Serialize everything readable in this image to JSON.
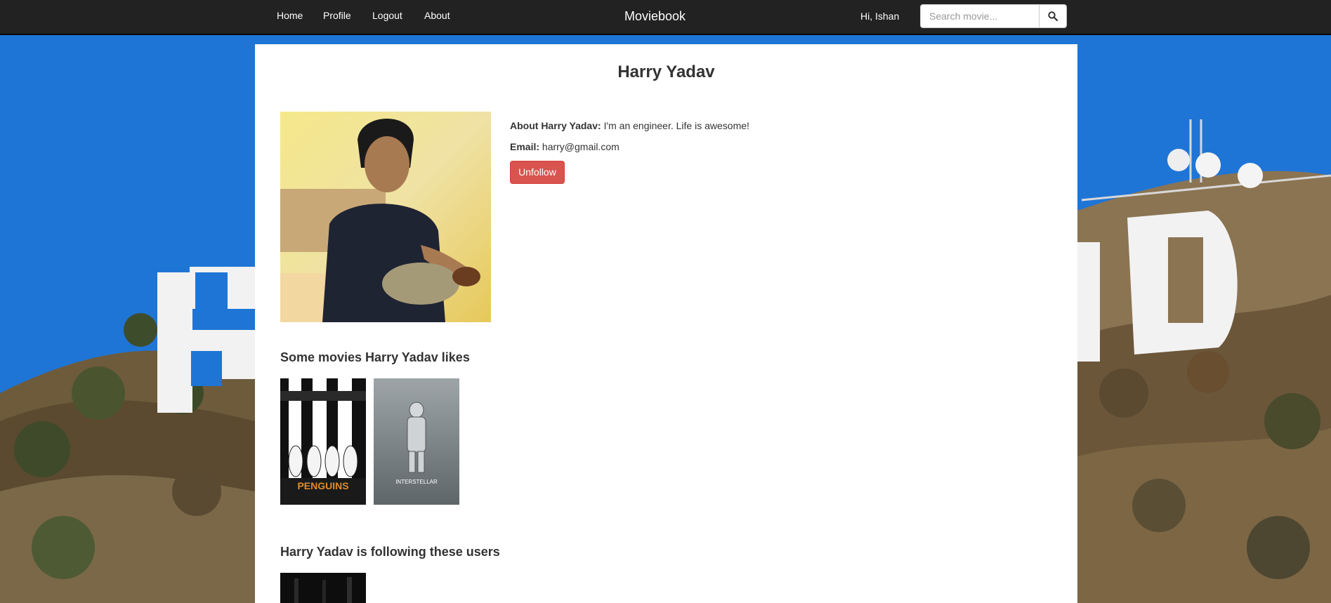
{
  "navbar": {
    "links": [
      "Home",
      "Profile",
      "Logout",
      "About"
    ],
    "brand": "Moviebook",
    "greeting": "Hi, Ishan",
    "search_placeholder": "Search movie..."
  },
  "profile": {
    "name": "Harry Yadav",
    "about_label": "About Harry Yadav:",
    "about_text": "I'm an engineer. Life is awesome!",
    "email_label": "Email:",
    "email": "harry@gmail.com",
    "unfollow_label": "Unfollow"
  },
  "sections": {
    "movies_title": "Some movies Harry Yadav likes",
    "following_title": "Harry Yadav is following these users"
  },
  "movies": [
    {
      "poster_text": "PENGUINS"
    },
    {
      "poster_text": "INTERSTELLAR"
    }
  ],
  "colors": {
    "navbar": "#222222",
    "danger": "#d9534f",
    "sky": "#1a6fd0"
  },
  "icons": {
    "search": "magnifier-icon"
  }
}
